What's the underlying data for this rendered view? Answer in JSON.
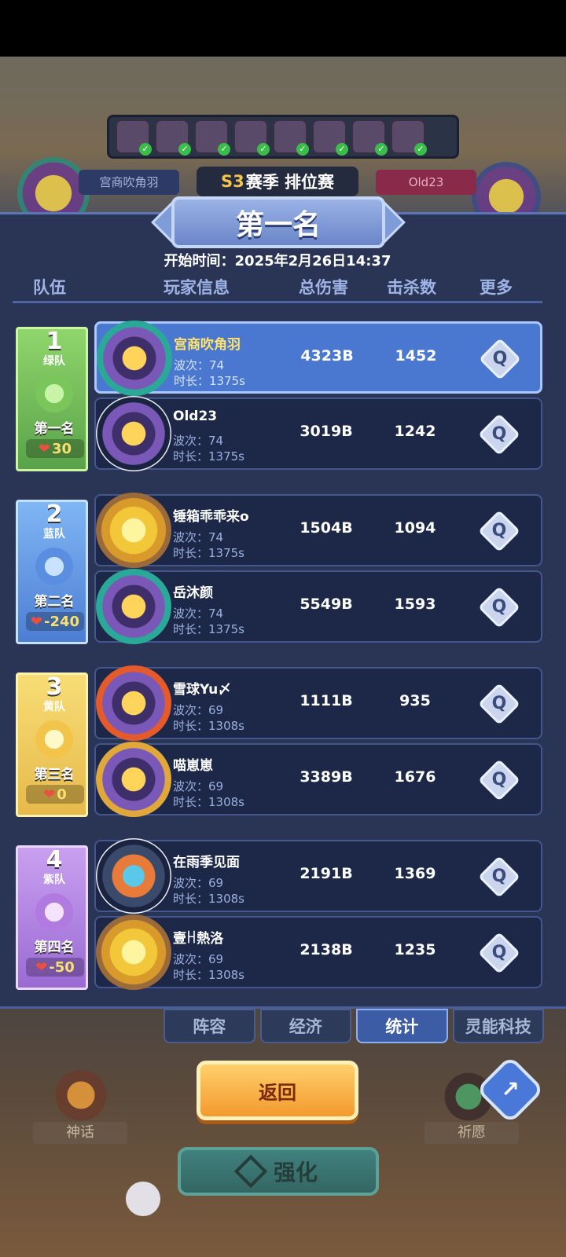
{
  "background": {
    "left_player_name": "宫商吹角羽",
    "right_player_name": "Old23",
    "season_label_prefix": "S3",
    "season_label_rest": "赛季 排位赛"
  },
  "banner": {
    "title": "第一名"
  },
  "start_time": "开始时间：2025年2月26日14:37",
  "headers": {
    "team": "队伍",
    "player": "玩家信息",
    "damage": "总伤害",
    "kills": "击杀数",
    "more": "更多"
  },
  "teams": [
    {
      "num": "1",
      "name": "绿队",
      "rank": "第一名",
      "score": "30"
    },
    {
      "num": "2",
      "name": "蓝队",
      "rank": "第二名",
      "score": "-240"
    },
    {
      "num": "3",
      "name": "黄队",
      "rank": "第三名",
      "score": "0"
    },
    {
      "num": "4",
      "name": "紫队",
      "rank": "第四名",
      "score": "-50"
    }
  ],
  "players": [
    {
      "name": "宫商吹角羽",
      "wave": "波次：74",
      "duration": "时长：1375s",
      "damage": "4323B",
      "kills": "1452"
    },
    {
      "name": "Old23",
      "wave": "波次：74",
      "duration": "时长：1375s",
      "damage": "3019B",
      "kills": "1242"
    },
    {
      "name": "锤箱乖乖来o",
      "wave": "波次：74",
      "duration": "时长：1375s",
      "damage": "1504B",
      "kills": "1094"
    },
    {
      "name": "岳沐颜",
      "wave": "波次：74",
      "duration": "时长：1375s",
      "damage": "5549B",
      "kills": "1593"
    },
    {
      "name": "雪球Yu〆",
      "wave": "波次：69",
      "duration": "时长：1308s",
      "damage": "1111B",
      "kills": "935"
    },
    {
      "name": "喵崽崽",
      "wave": "波次：69",
      "duration": "时长：1308s",
      "damage": "3389B",
      "kills": "1676"
    },
    {
      "name": "在雨季见面",
      "wave": "波次：69",
      "duration": "时长：1308s",
      "damage": "2191B",
      "kills": "1369"
    },
    {
      "name": "壹ꀿ熱洛",
      "wave": "波次：69",
      "duration": "时长：1308s",
      "damage": "2138B",
      "kills": "1235"
    }
  ],
  "more_icon": "magnifier-icon",
  "tabs": [
    "阵容",
    "经济",
    "统计",
    "灵能科技"
  ],
  "active_tab": "统计",
  "back_button": "返回",
  "bottom": {
    "myth": "神话",
    "pray": "祈愿",
    "enhance": "强化"
  },
  "colors": {
    "panel": "#2a3556",
    "highlight_row": "#4a78d0",
    "back_button": "#f39a2e",
    "damage_text": "#ffffff",
    "name_highlight": "#ffe36a"
  }
}
